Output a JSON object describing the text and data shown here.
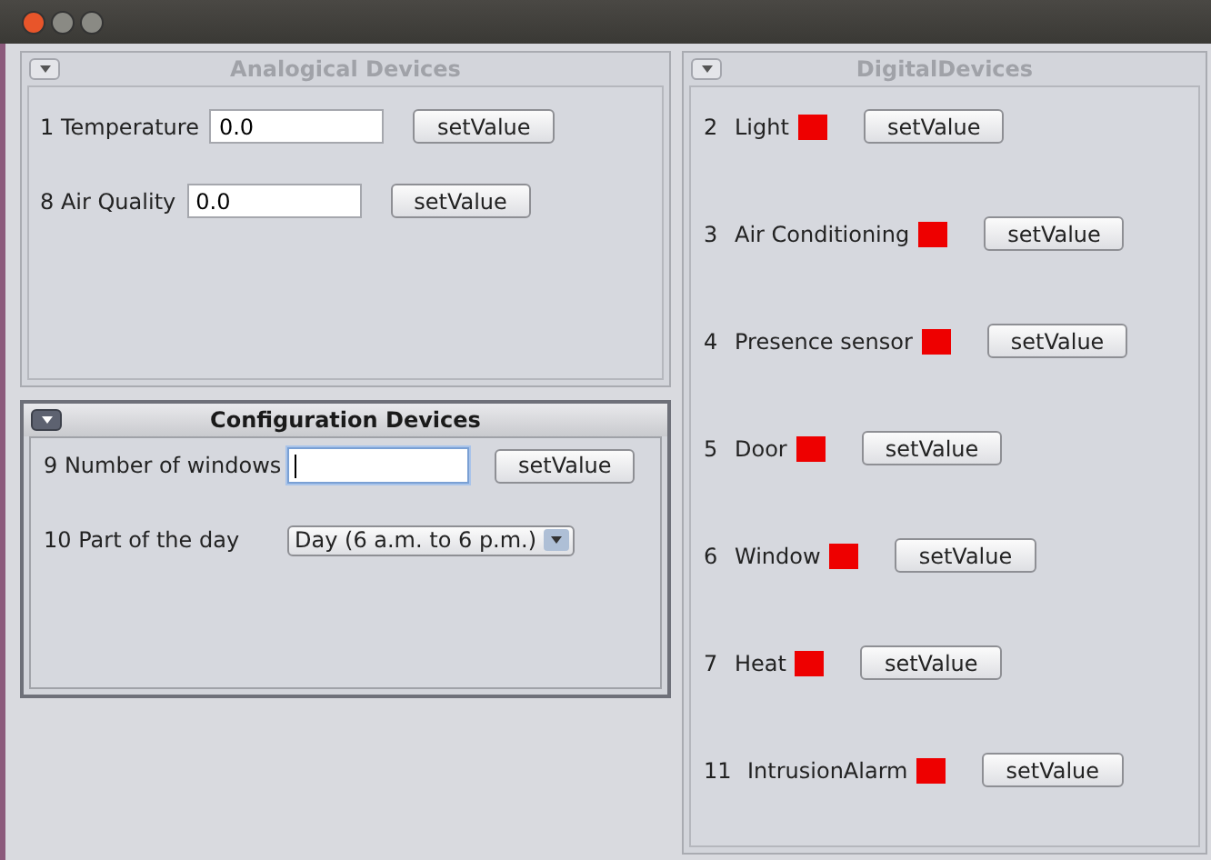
{
  "analog": {
    "title": "Analogical Devices",
    "active": false,
    "rows": [
      {
        "id": "1",
        "label": "Temperature",
        "value": "0.0",
        "button": "setValue"
      },
      {
        "id": "8",
        "label": "Air Quality",
        "value": "0.0",
        "button": "setValue"
      }
    ]
  },
  "config": {
    "title": "Configuration Devices",
    "active": true,
    "rows": [
      {
        "kind": "text",
        "id": "9",
        "label": "Number of windows",
        "value": "",
        "focused": true,
        "button": "setValue"
      },
      {
        "kind": "combo",
        "id": "10",
        "label": "Part of the day",
        "value": "Day (6 a.m. to 6 p.m.)"
      }
    ]
  },
  "digital": {
    "title": "DigitalDevices",
    "active": false,
    "rows": [
      {
        "id": "2",
        "label": "Light",
        "color": "#ee0000",
        "button": "setValue"
      },
      {
        "id": "3",
        "label": "Air Conditioning",
        "color": "#ee0000",
        "button": "setValue"
      },
      {
        "id": "4",
        "label": "Presence sensor",
        "color": "#ee0000",
        "button": "setValue"
      },
      {
        "id": "5",
        "label": "Door",
        "color": "#ee0000",
        "button": "setValue"
      },
      {
        "id": "6",
        "label": "Window",
        "color": "#ee0000",
        "button": "setValue"
      },
      {
        "id": "7",
        "label": "Heat",
        "color": "#ee0000",
        "button": "setValue"
      },
      {
        "id": "11",
        "label": "IntrusionAlarm",
        "color": "#ee0000",
        "button": "setValue"
      }
    ]
  }
}
